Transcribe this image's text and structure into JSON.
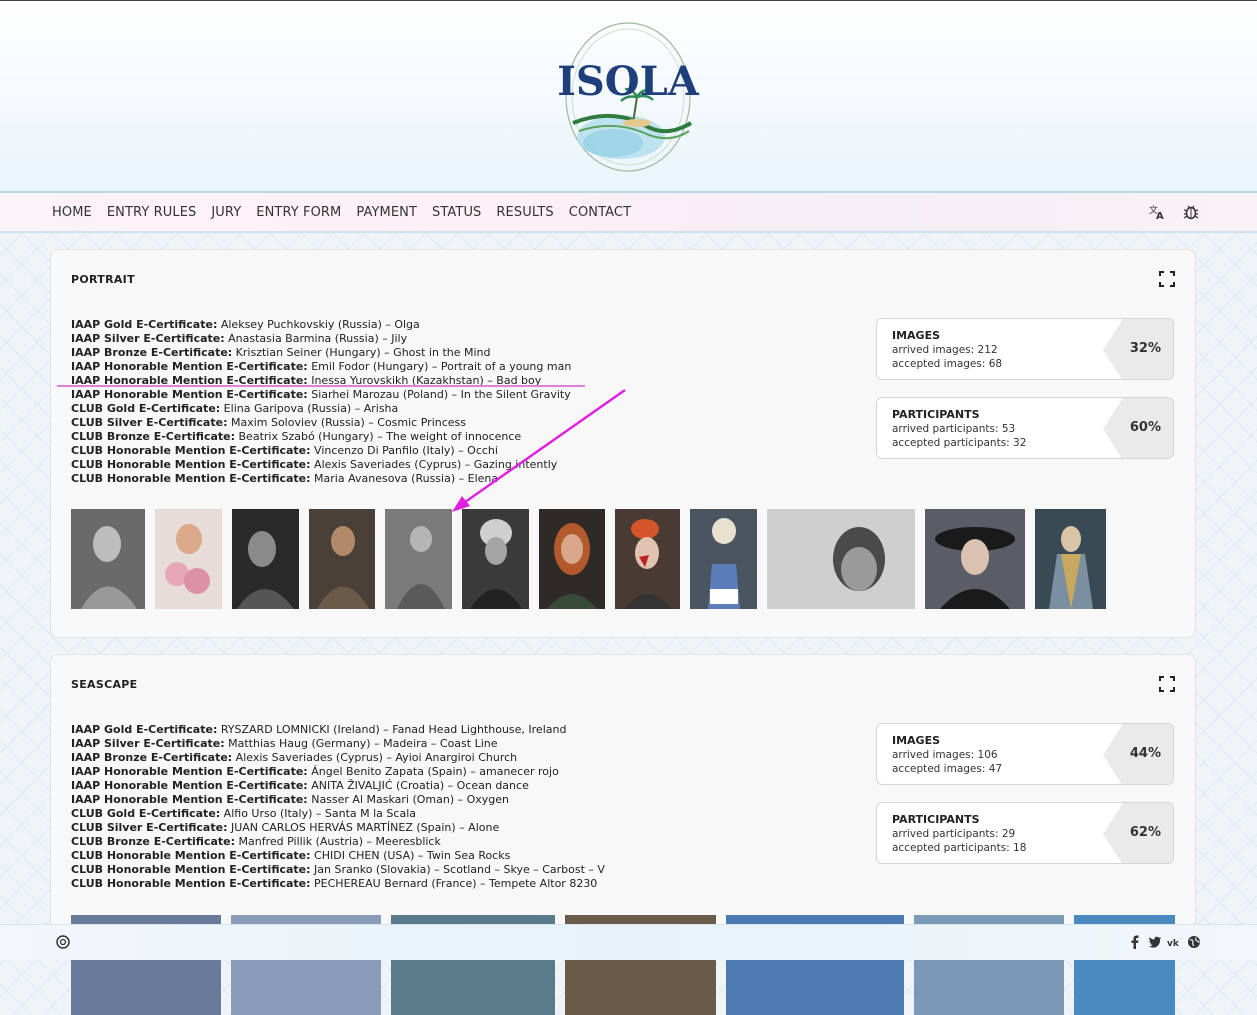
{
  "logo": {
    "text": "ISOLA"
  },
  "nav": {
    "items": [
      "HOME",
      "ENTRY RULES",
      "JURY",
      "ENTRY FORM",
      "PAYMENT",
      "STATUS",
      "RESULTS",
      "CONTACT"
    ],
    "icons": [
      "translate-icon",
      "bug-icon"
    ]
  },
  "sections": [
    {
      "title": "PORTRAIT",
      "awards": [
        {
          "award": "IAAP Gold E-Certificate:",
          "text": " Aleksey Puchkovskiy (Russia) – Olga"
        },
        {
          "award": "IAAP Silver E-Certificate:",
          "text": " Anastasia Barmina (Russia) – Jily"
        },
        {
          "award": "IAAP Bronze E-Certificate:",
          "text": " Krisztian Seiner (Hungary) – Ghost in the Mind"
        },
        {
          "award": "IAAP Honorable Mention E-Certificate:",
          "text": " Emil Fodor (Hungary) – Portrait of a young man"
        },
        {
          "award": "IAAP Honorable Mention E-Certificate:",
          "text": " Inessa Yurovskikh (Kazakhstan) – Bad boy"
        },
        {
          "award": "IAAP Honorable Mention E-Certificate:",
          "text": " Siarhei Marozau (Poland) – In the Silent Gravity"
        },
        {
          "award": "CLUB Gold E-Certificate:",
          "text": " Elina Garipova (Russia) – Arisha"
        },
        {
          "award": "CLUB Silver E-Certificate:",
          "text": " Maxim Soloviev (Russia) – Cosmic Princess"
        },
        {
          "award": "CLUB Bronze E-Certificate:",
          "text": " Beatrix Szabó (Hungary) – The weight of innocence"
        },
        {
          "award": "CLUB Honorable Mention E-Certificate:",
          "text": " Vincenzo Di Panfilo (Italy) – Occhi"
        },
        {
          "award": "CLUB Honorable Mention E-Certificate:",
          "text": " Alexis Saveriades (Cyprus) – Gazing intently"
        },
        {
          "award": "CLUB Honorable Mention E-Certificate:",
          "text": " Maria Avanesova (Russia) – Elena"
        }
      ],
      "images_stat": {
        "head": "IMAGES",
        "arrived": "arrived images: 212",
        "accepted": "accepted images: 68",
        "pct": "32%"
      },
      "participants_stat": {
        "head": "PARTICIPANTS",
        "arrived": "arrived participants: 53",
        "accepted": "accepted participants: 32",
        "pct": "60%"
      }
    },
    {
      "title": "SEASCAPE",
      "awards": [
        {
          "award": "IAAP Gold E-Certificate:",
          "text": " RYSZARD LOMNICKI (Ireland) – Fanad Head Lighthouse, Ireland"
        },
        {
          "award": "IAAP Silver E-Certificate:",
          "text": " Matthias Haug (Germany) – Madeira – Coast Line"
        },
        {
          "award": "IAAP Bronze E-Certificate:",
          "text": " Alexis Saveriades (Cyprus) – Ayioi Anargiroi Church"
        },
        {
          "award": "IAAP Honorable Mention E-Certificate:",
          "text": " Ángel Benito Zapata (Spain) – amanecer rojo"
        },
        {
          "award": "IAAP Honorable Mention E-Certificate:",
          "text": " ANITA ŽIVALJIĆ (Croatia) – Ocean dance"
        },
        {
          "award": "IAAP Honorable Mention E-Certificate:",
          "text": " Nasser Al Maskari (Oman) – Oxygen"
        },
        {
          "award": "CLUB Gold E-Certificate:",
          "text": " Alfio Urso (Italy) – Santa M la Scala"
        },
        {
          "award": "CLUB Silver E-Certificate:",
          "text": " JUAN CARLOS HERVÁS MARTÍNEZ (Spain) – Alone"
        },
        {
          "award": "CLUB Bronze E-Certificate:",
          "text": " Manfred Pillik (Austria) – Meeresblick"
        },
        {
          "award": "CLUB Honorable Mention E-Certificate:",
          "text": " CHIDI CHEN (USA) – Twin Sea Rocks"
        },
        {
          "award": "CLUB Honorable Mention E-Certificate:",
          "text": " Jan Sranko (Slovakia) – Scotland – Skye – Carbost – V"
        },
        {
          "award": "CLUB Honorable Mention E-Certificate:",
          "text": " PECHEREAU Bernard (France) – Tempete Altor 8230"
        }
      ],
      "images_stat": {
        "head": "IMAGES",
        "arrived": "arrived images: 106",
        "accepted": "accepted images: 47",
        "pct": "44%"
      },
      "participants_stat": {
        "head": "PARTICIPANTS",
        "arrived": "arrived participants: 29",
        "accepted": "accepted participants: 18",
        "pct": "62%"
      }
    }
  ],
  "colors": {
    "annotation": "#e020e0",
    "nav_border": "#bcd7e6",
    "card_bg": "#f8f8f8"
  },
  "footer": {
    "icons": [
      "privacy-icon",
      "facebook-icon",
      "twitter-icon",
      "vk-icon",
      "web-icon"
    ]
  }
}
